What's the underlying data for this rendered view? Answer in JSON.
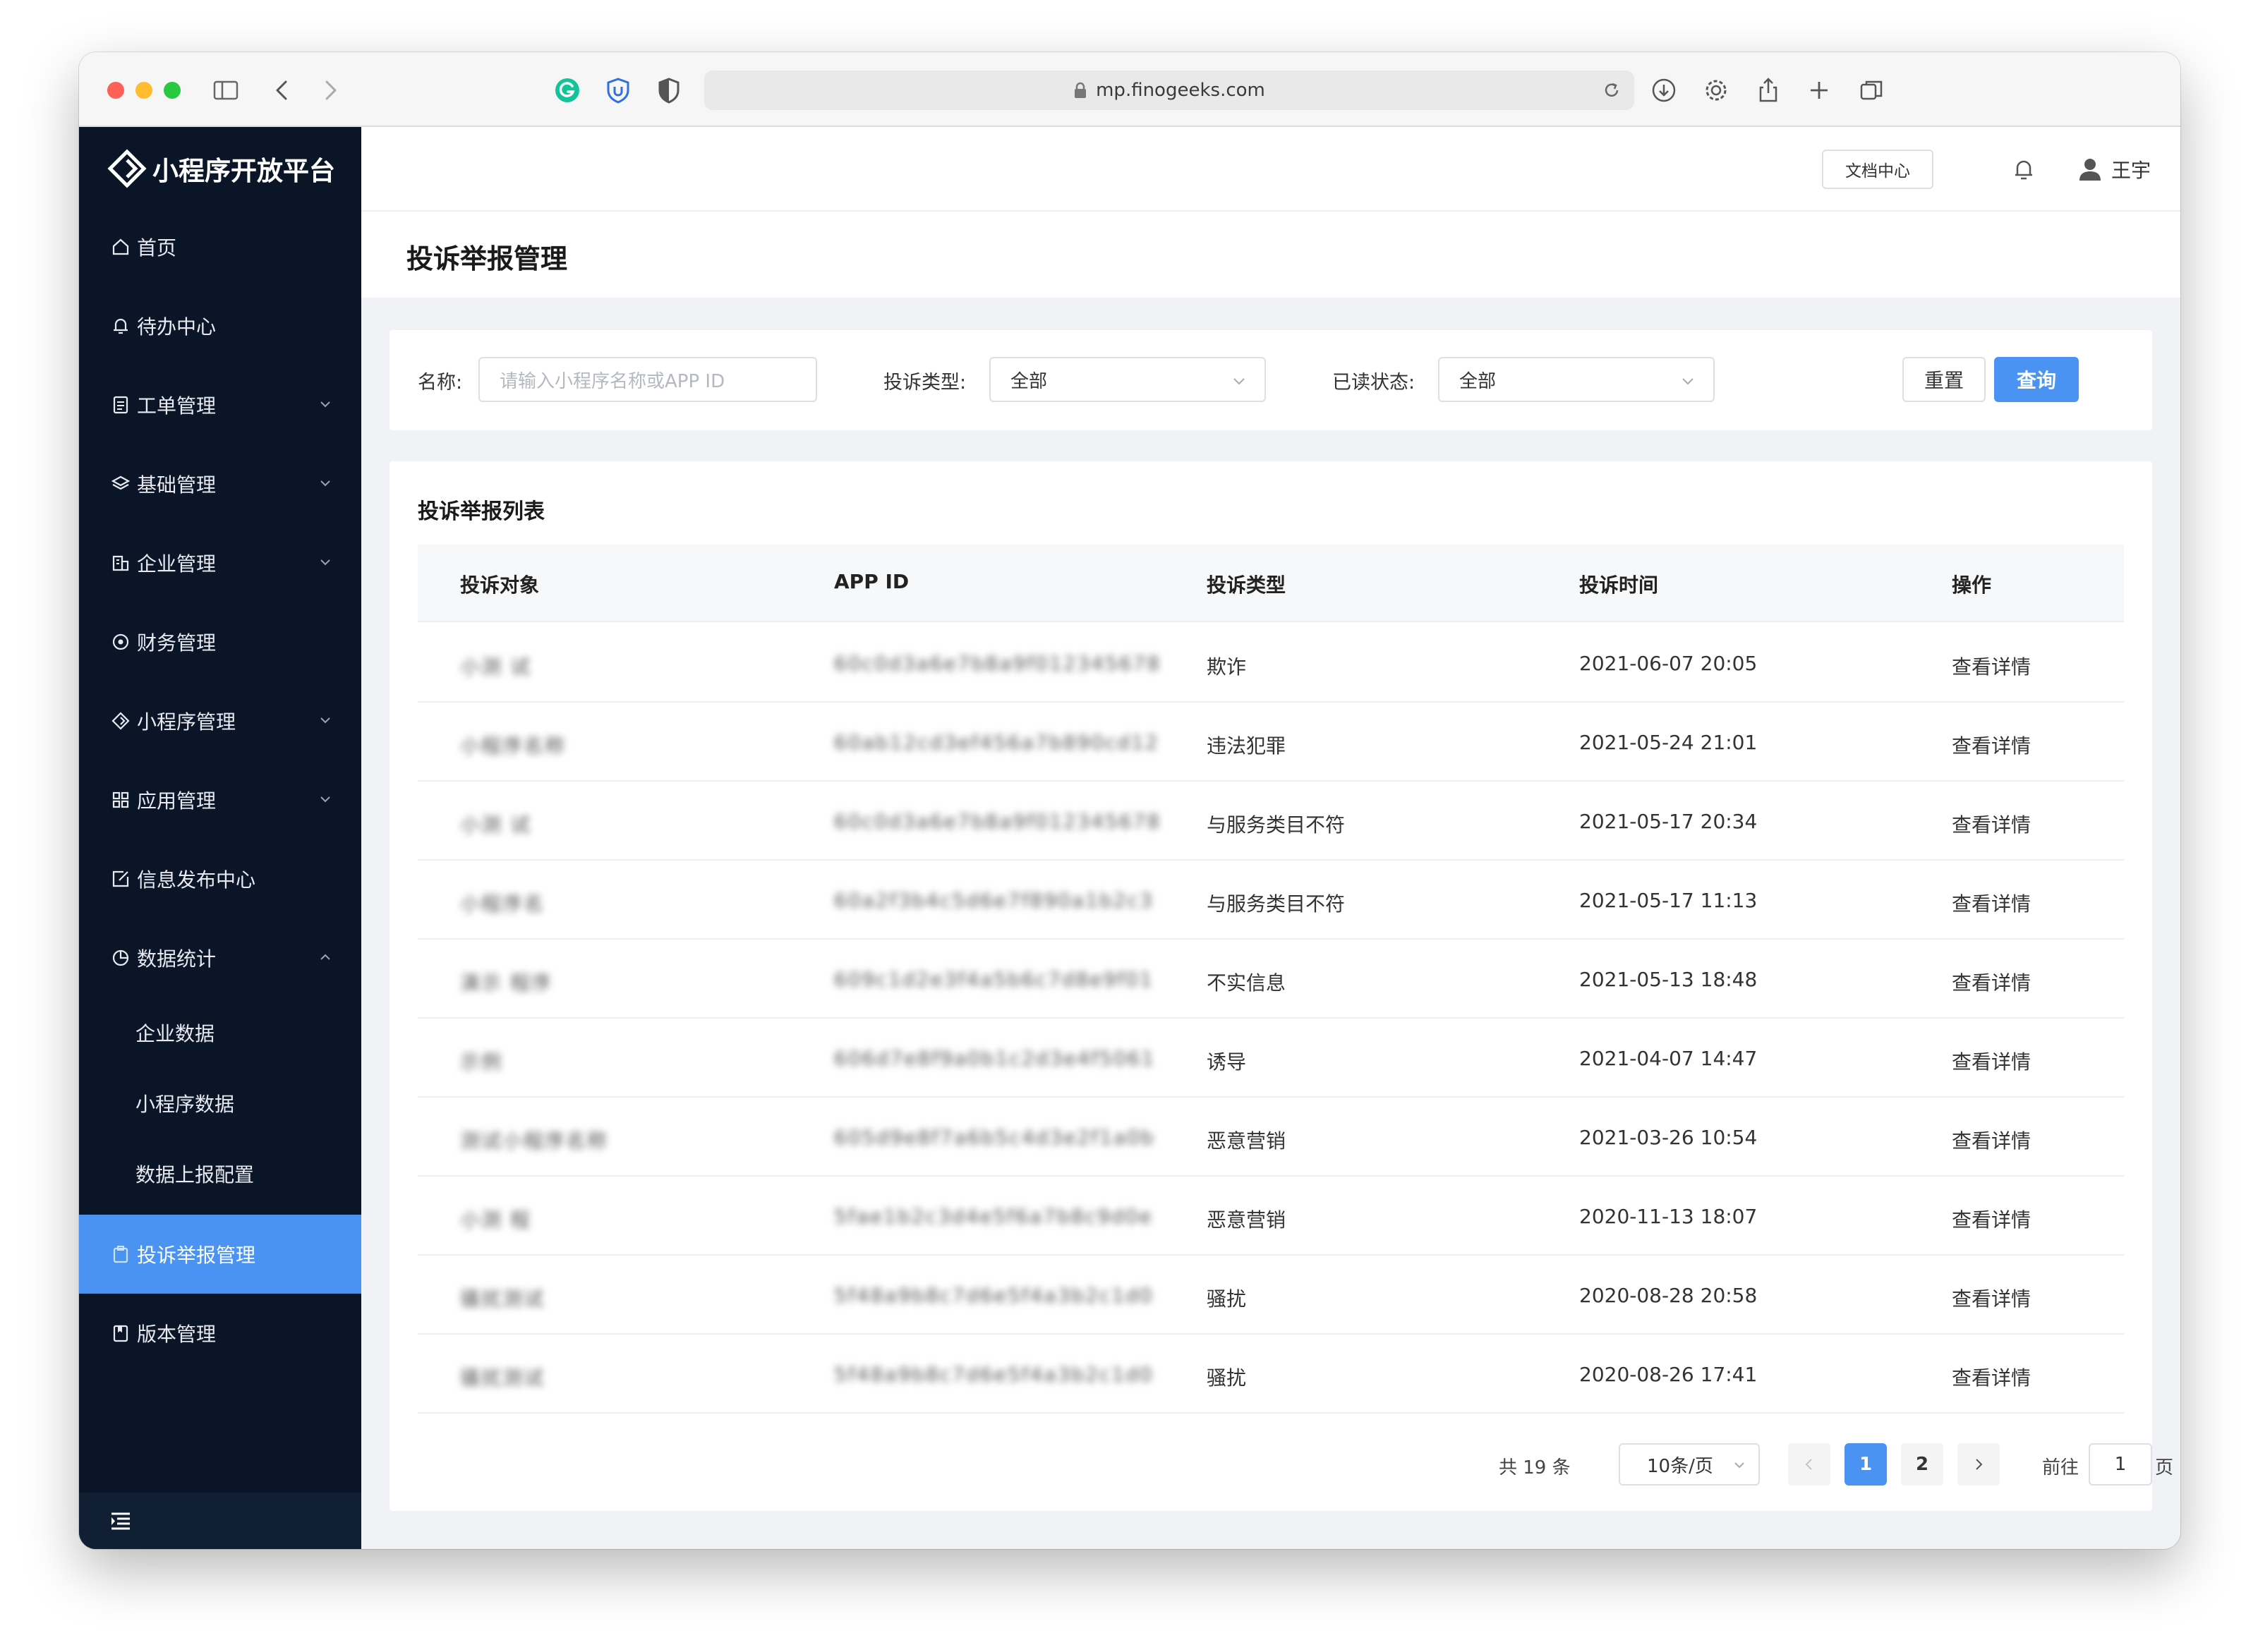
{
  "browser": {
    "url": "mp.finogeeks.com"
  },
  "sidebar": {
    "brand": "小程序开放平台",
    "items": [
      {
        "label": "首页",
        "icon": "home-icon"
      },
      {
        "label": "待办中心",
        "icon": "bell-icon"
      },
      {
        "label": "工单管理",
        "icon": "document-icon"
      },
      {
        "label": "基础管理",
        "icon": "layers-icon"
      },
      {
        "label": "企业管理",
        "icon": "building-icon"
      },
      {
        "label": "财务管理",
        "icon": "coin-icon"
      },
      {
        "label": "小程序管理",
        "icon": "diamond-icon"
      },
      {
        "label": "应用管理",
        "icon": "grid-icon"
      },
      {
        "label": "信息发布中心",
        "icon": "edit-icon"
      },
      {
        "label": "数据统计",
        "icon": "pie-chart-icon"
      }
    ],
    "sub_items": [
      "企业数据",
      "小程序数据",
      "数据上报配置"
    ],
    "active_item": {
      "label": "投诉举报管理",
      "icon": "clipboard-icon"
    },
    "last_item": {
      "label": "版本管理",
      "icon": "book-icon"
    }
  },
  "header": {
    "doc_center": "文档中心",
    "user_name": "王宇"
  },
  "page": {
    "title": "投诉举报管理"
  },
  "filters": {
    "name_label": "名称:",
    "name_placeholder": "请输入小程序名称或APP ID",
    "type_label": "投诉类型:",
    "type_value": "全部",
    "read_label": "已读状态:",
    "read_value": "全部",
    "reset_label": "重置",
    "query_label": "查询"
  },
  "table": {
    "title": "投诉举报列表",
    "columns": [
      "投诉对象",
      "APP ID",
      "投诉类型",
      "投诉时间",
      "操作"
    ],
    "rows": [
      {
        "target": "小测 试",
        "app_id": "60c0d3a6e7b8a9f012345678",
        "type": "欺诈",
        "time": "2021-06-07 20:05",
        "action": "查看详情"
      },
      {
        "target": "小程序名称",
        "app_id": "60ab12cd3ef456a7b890cd12",
        "type": "违法犯罪",
        "time": "2021-05-24 21:01",
        "action": "查看详情"
      },
      {
        "target": "小测 试",
        "app_id": "60c0d3a6e7b8a9f012345678",
        "type": "与服务类目不符",
        "time": "2021-05-17 20:34",
        "action": "查看详情"
      },
      {
        "target": "小程序名",
        "app_id": "60a2f3b4c5d6e7f890a1b2c3",
        "type": "与服务类目不符",
        "time": "2021-05-17 11:13",
        "action": "查看详情"
      },
      {
        "target": "演示 程序",
        "app_id": "609c1d2e3f4a5b6c7d8e9f01",
        "type": "不实信息",
        "time": "2021-05-13 18:48",
        "action": "查看详情"
      },
      {
        "target": "示例",
        "app_id": "606d7e8f9a0b1c2d3e4f5061",
        "type": "诱导",
        "time": "2021-04-07 14:47",
        "action": "查看详情"
      },
      {
        "target": "测试小程序名称",
        "app_id": "605d9e8f7a6b5c4d3e2f1a0b",
        "type": "恶意营销",
        "time": "2021-03-26 10:54",
        "action": "查看详情"
      },
      {
        "target": "小测 程",
        "app_id": "5fae1b2c3d4e5f6a7b8c9d0e",
        "type": "恶意营销",
        "time": "2020-11-13 18:07",
        "action": "查看详情"
      },
      {
        "target": "骚扰测试",
        "app_id": "5f48a9b8c7d6e5f4a3b2c1d0",
        "type": "骚扰",
        "time": "2020-08-28 20:58",
        "action": "查看详情"
      },
      {
        "target": "骚扰测试",
        "app_id": "5f48a9b8c7d6e5f4a3b2c1d0",
        "type": "骚扰",
        "time": "2020-08-26 17:41",
        "action": "查看详情"
      }
    ]
  },
  "pagination": {
    "total": "共 19 条",
    "page_size": "10条/页",
    "pages": [
      "1",
      "2"
    ],
    "current_page": "1",
    "goto_label": "前往",
    "goto_value": "1",
    "page_unit": "页"
  },
  "colors": {
    "sidebar_bg": "#0a1628",
    "accent": "#4b93f2"
  }
}
